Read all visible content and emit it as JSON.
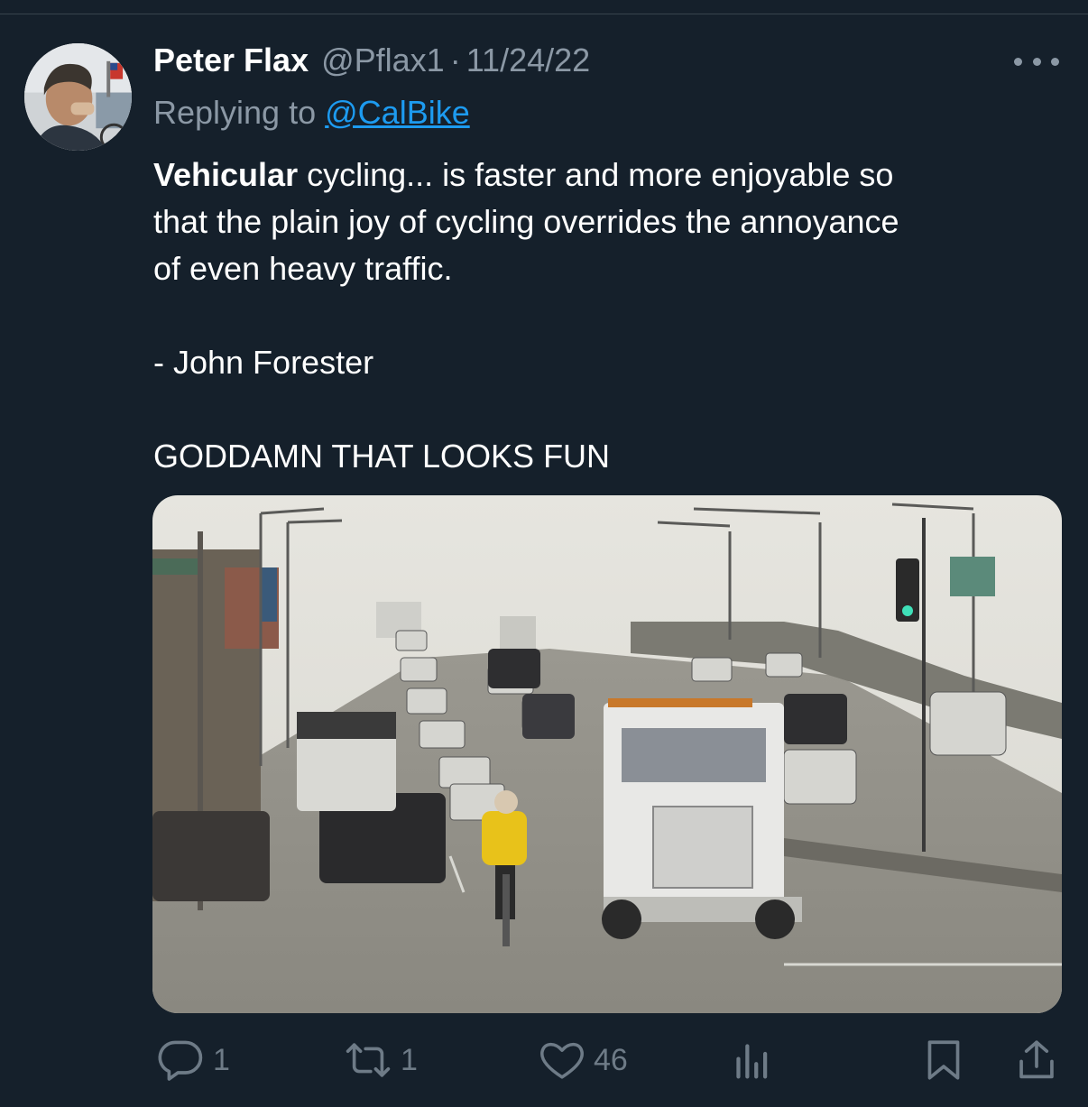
{
  "tweet": {
    "author_name": "Peter Flax",
    "author_handle": "@Pflax1",
    "separator": "·",
    "date": "11/24/22",
    "replying_prefix": "Replying to",
    "replying_handle": "@CalBike",
    "text_bold": "Vehicular",
    "text_line1_rest": " cycling... is faster and more enjoyable so",
    "text_line2": "that the plain joy of cycling overrides the annoyance",
    "text_line3": "of even heavy traffic.",
    "attribution": "- John Forester",
    "comment": "GODDAMN THAT LOOKS FUN"
  },
  "actions": {
    "replies": "1",
    "retweets": "1",
    "likes": "46"
  },
  "icons": {
    "more": "more-horizontal-icon",
    "reply": "reply-icon",
    "retweet": "retweet-icon",
    "like": "heart-icon",
    "views": "views-chart-icon",
    "bookmark": "bookmark-icon",
    "share": "share-icon"
  },
  "colors": {
    "background": "#15202b",
    "text": "#ffffff",
    "secondary": "#8b98a5",
    "link": "#1d9bf0",
    "icon": "#6e7b87"
  }
}
